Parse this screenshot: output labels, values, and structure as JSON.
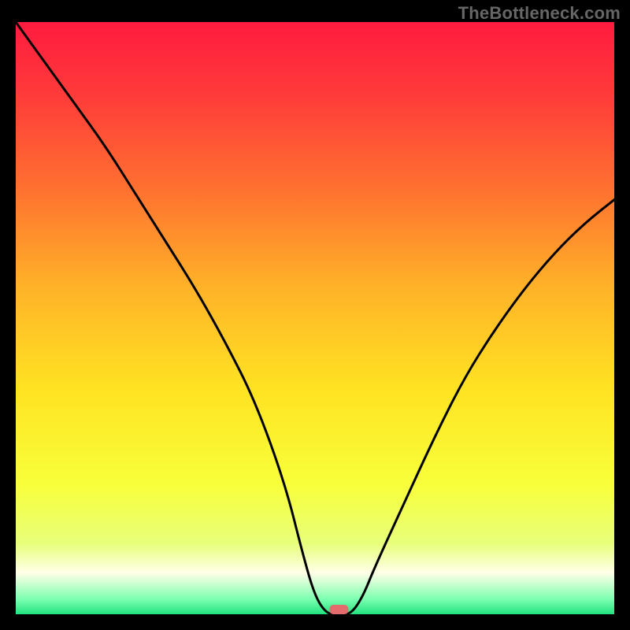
{
  "watermark": "TheBottleneck.com",
  "chart_data": {
    "type": "line",
    "title": "",
    "xlabel": "",
    "ylabel": "",
    "xlim": [
      0,
      100
    ],
    "ylim": [
      0,
      100
    ],
    "x": [
      0,
      5,
      10,
      15,
      20,
      25,
      30,
      35,
      40,
      45,
      48,
      50,
      52,
      54,
      56,
      58,
      60,
      65,
      70,
      75,
      80,
      85,
      90,
      95,
      100
    ],
    "values": [
      100,
      93,
      86,
      79,
      71,
      63,
      55,
      46,
      36,
      22,
      10,
      3,
      0,
      0,
      0,
      3,
      8,
      19,
      30,
      40,
      48,
      55,
      61,
      66,
      70
    ],
    "marker": {
      "x": 54,
      "y": 0,
      "color": "#e36b6b"
    },
    "gradient_stops": [
      {
        "offset": 0.0,
        "color": "#ff1b3f"
      },
      {
        "offset": 0.12,
        "color": "#ff3a3a"
      },
      {
        "offset": 0.28,
        "color": "#ff7030"
      },
      {
        "offset": 0.45,
        "color": "#ffb328"
      },
      {
        "offset": 0.62,
        "color": "#ffe322"
      },
      {
        "offset": 0.78,
        "color": "#f8ff3a"
      },
      {
        "offset": 0.88,
        "color": "#e8ff7a"
      },
      {
        "offset": 0.93,
        "color": "#ffffe8"
      },
      {
        "offset": 0.955,
        "color": "#b8ffc8"
      },
      {
        "offset": 0.975,
        "color": "#7affb0"
      },
      {
        "offset": 1.0,
        "color": "#21e27e"
      }
    ]
  }
}
